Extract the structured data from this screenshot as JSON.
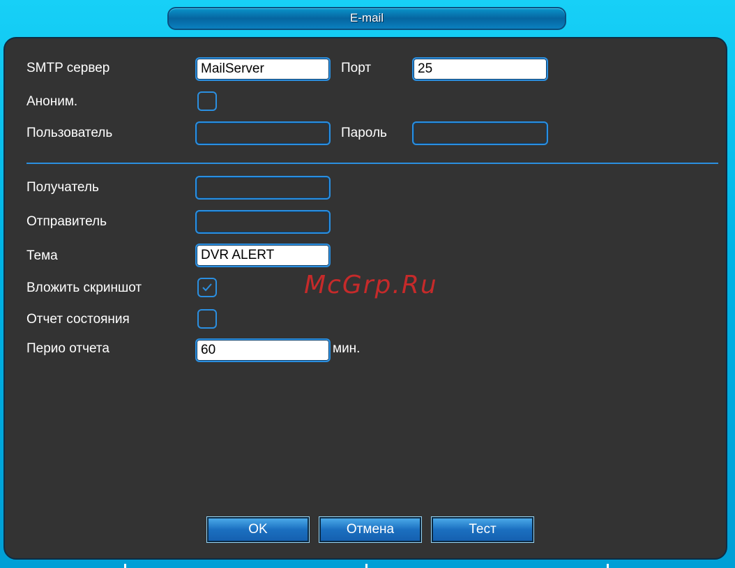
{
  "window": {
    "title": "E-mail"
  },
  "smtp": {
    "label": "SMTP сервер",
    "value": "MailServer"
  },
  "port": {
    "label": "Порт",
    "value": "25"
  },
  "anon": {
    "label": "Аноним.",
    "checked": false
  },
  "user": {
    "label": "Пользователь",
    "value": ""
  },
  "password": {
    "label": "Пароль",
    "value": ""
  },
  "recipient": {
    "label": "Получатель",
    "value": ""
  },
  "sender": {
    "label": "Отправитель",
    "value": ""
  },
  "subject": {
    "label": "Тема",
    "value": "DVR ALERT"
  },
  "attach": {
    "label": "Вложить скриншот",
    "checked": true
  },
  "status_report": {
    "label": "Отчет состояния",
    "checked": false
  },
  "period": {
    "label": "Перио отчета",
    "value": "60",
    "unit": "мин."
  },
  "buttons": {
    "ok": "OK",
    "cancel": "Отмена",
    "test": "Тест"
  },
  "watermark": "McGrp.Ru",
  "colors": {
    "accent": "#2b8fe0",
    "panel": "#333333",
    "frame": "#00b4e6"
  }
}
